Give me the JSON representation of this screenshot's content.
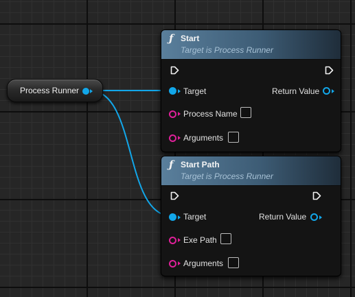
{
  "graph": {
    "variable_node": {
      "label": "Process Runner",
      "pin_color": "#12a7ea"
    },
    "function_nodes": [
      {
        "id": "start",
        "glyph": "ƒ",
        "title": "Start",
        "subtitle": "Target is Process Runner",
        "pins": {
          "target": "Target",
          "return_value": "Return Value",
          "string_inputs": [
            "Process Name",
            "Arguments"
          ]
        }
      },
      {
        "id": "start-path",
        "glyph": "ƒ",
        "title": "Start Path",
        "subtitle": "Target is Process Runner",
        "pins": {
          "target": "Target",
          "return_value": "Return Value",
          "string_inputs": [
            "Exe Path",
            "Arguments"
          ]
        }
      }
    ],
    "colors": {
      "object_pin": "#12a7ea",
      "string_pin": "#e0209a",
      "header_accent": "#5a7f9c",
      "grid_background": "#262626"
    },
    "icons": [
      "function-icon",
      "exec-in-icon",
      "exec-out-icon",
      "object-pin-icon",
      "string-pin-icon"
    ]
  }
}
